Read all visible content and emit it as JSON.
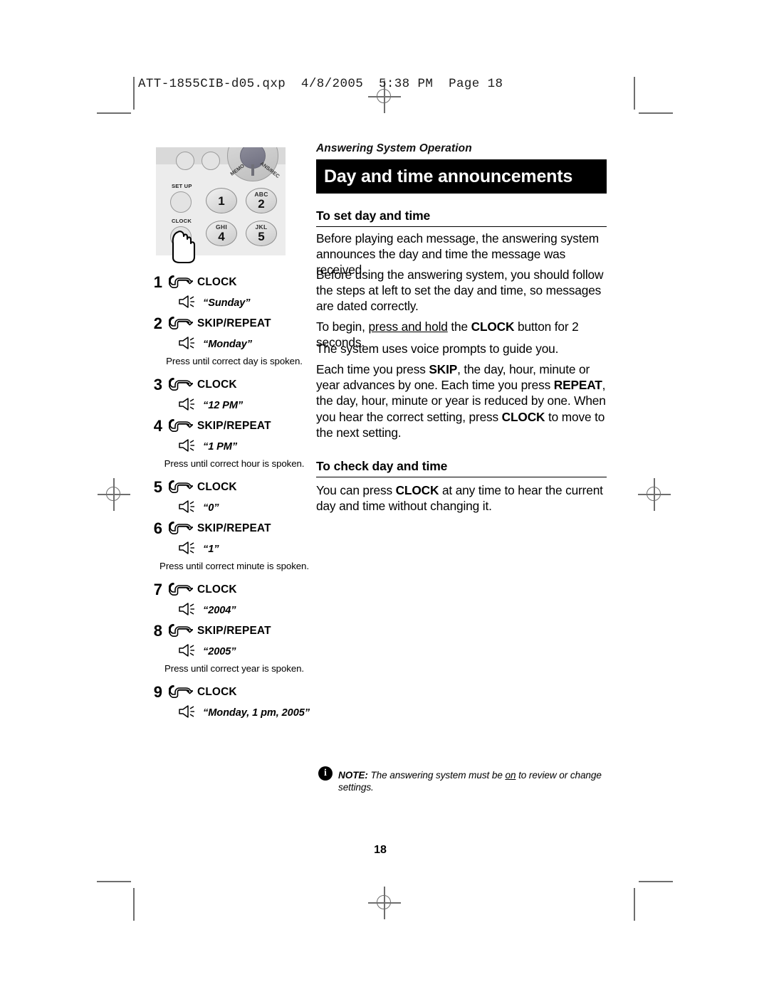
{
  "printer_slug": "ATT-1855CIB-d05.qxp  4/8/2005  5:38 PM  Page 18",
  "header": {
    "eyebrow": "Answering System Operation",
    "title": "Day and time announcements"
  },
  "sections": {
    "set_heading": "To set day and time",
    "check_heading": "To check day and time"
  },
  "body": {
    "p1": "Before playing each message, the answering system announces the day and time the message was received.",
    "p2": "Before using the answering system, you should follow the steps at left to set the day and time, so messages are dated correctly.",
    "p3_a": "To begin, ",
    "p3_b": "press and hold",
    "p3_c": " the ",
    "p3_d": "CLOCK",
    "p3_e": " button for 2 seconds.",
    "p4": "The system uses voice prompts to guide you.",
    "p5_a": "Each time you press ",
    "p5_b": "SKIP",
    "p5_c": ", the day, hour, minute or year advances by one. Each time you press ",
    "p5_d": "REPEAT",
    "p5_e": ", the day, hour, minute or year is reduced by one. When you hear the correct setting, press ",
    "p5_f": "CLOCK",
    "p5_g": " to move to the next setting.",
    "p6_a": "You can press ",
    "p6_b": "CLOCK",
    "p6_c": " at any time to hear the current day and time without changing it."
  },
  "steps": [
    {
      "num": "1",
      "button": "CLOCK",
      "says": "“Sunday”",
      "hint": ""
    },
    {
      "num": "2",
      "button": "SKIP/REPEAT",
      "says": "“Monday”",
      "hint": "Press until correct day is spoken."
    },
    {
      "num": "3",
      "button": "CLOCK",
      "says": "“12 PM”",
      "hint": ""
    },
    {
      "num": "4",
      "button": "SKIP/REPEAT",
      "says": "“1 PM”",
      "hint": "Press until correct hour is spoken."
    },
    {
      "num": "5",
      "button": "CLOCK",
      "says": "“0”",
      "hint": ""
    },
    {
      "num": "6",
      "button": "SKIP/REPEAT",
      "says": "“1”",
      "hint": "Press until correct minute is spoken."
    },
    {
      "num": "7",
      "button": "CLOCK",
      "says": "“2004”",
      "hint": ""
    },
    {
      "num": "8",
      "button": "SKIP/REPEAT",
      "says": "“2005”",
      "hint": "Press until correct year is spoken."
    },
    {
      "num": "9",
      "button": "CLOCK",
      "says": "“Monday, 1 pm, 2005”",
      "hint": ""
    }
  ],
  "keypad": {
    "setup_label": "SET UP",
    "clock_label": "CLOCK",
    "dial_left_label": "MEMO",
    "dial_right_label": "ANS/REC",
    "keys": [
      {
        "letters": "",
        "digit": "1"
      },
      {
        "letters": "ABC",
        "digit": "2"
      },
      {
        "letters": "GHI",
        "digit": "4"
      },
      {
        "letters": "JKL",
        "digit": "5"
      }
    ]
  },
  "note": {
    "icon": "info-icon",
    "label": "NOTE:",
    "text_a": " The answering system must be ",
    "text_b": "on",
    "text_c": " to review or change settings."
  },
  "folio": "18",
  "colors": {
    "title_bar_bg": "#000000",
    "title_text": "#ffffff",
    "page_bg": "#ffffff",
    "mark_gray": "#6e6e6e",
    "keypad_bg": "#ececec"
  }
}
